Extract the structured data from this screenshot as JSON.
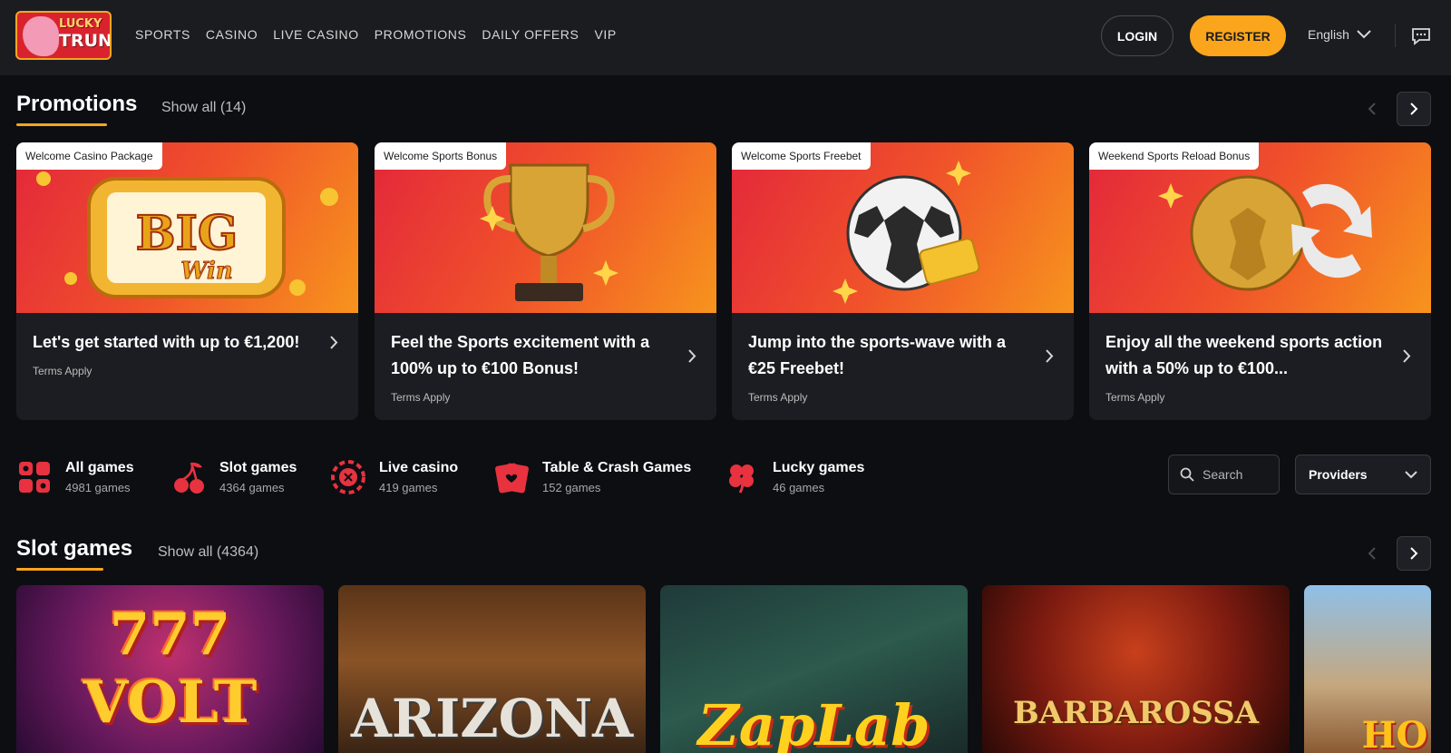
{
  "header": {
    "logo_line1": "LUCKY",
    "logo_line2": "TRUNK",
    "nav": [
      "SPORTS",
      "CASINO",
      "LIVE CASINO",
      "PROMOTIONS",
      "DAILY OFFERS",
      "VIP"
    ],
    "login_label": "LOGIN",
    "register_label": "REGISTER",
    "language": "English"
  },
  "colors": {
    "accent": "#fba51c",
    "background": "#0c0e12",
    "card": "#1c1d22",
    "header": "#1b1c20"
  },
  "promotions": {
    "title": "Promotions",
    "show_all": "Show all (14)",
    "cards": [
      {
        "tag": "Welcome Casino Package",
        "title": "Let's get started with up to €1,200!",
        "terms": "Terms Apply",
        "art": "BIG"
      },
      {
        "tag": "Welcome Sports Bonus",
        "title": "Feel the Sports excitement with a 100% up to €100 Bonus!",
        "terms": "Terms Apply",
        "art": "trophy"
      },
      {
        "tag": "Welcome Sports Freebet",
        "title": "Jump into the sports-wave with a €25 Freebet!",
        "terms": "Terms Apply",
        "art": "ball"
      },
      {
        "tag": "Weekend Sports Reload Bonus",
        "title": "Enjoy all the weekend sports action with a 50% up to €100...",
        "terms": "Terms Apply",
        "art": "gold-ball"
      }
    ]
  },
  "categories": [
    {
      "name": "All games",
      "count": "4981 games",
      "icon": "grid-icon"
    },
    {
      "name": "Slot games",
      "count": "4364 games",
      "icon": "cherry-icon"
    },
    {
      "name": "Live casino",
      "count": "419 games",
      "icon": "chip-icon"
    },
    {
      "name": "Table & Crash Games",
      "count": "152 games",
      "icon": "card-icon"
    },
    {
      "name": "Lucky games",
      "count": "46 games",
      "icon": "clover-icon"
    }
  ],
  "search": {
    "placeholder": "Search"
  },
  "providers": {
    "label": "Providers"
  },
  "slots": {
    "title": "Slot games",
    "show_all": "Show all (4364)",
    "games": [
      {
        "name": "777 VOLT"
      },
      {
        "name": "ARIZONA"
      },
      {
        "name": "ZapLab"
      },
      {
        "name": "BARBAROSSA"
      },
      {
        "name": "HO"
      }
    ]
  }
}
